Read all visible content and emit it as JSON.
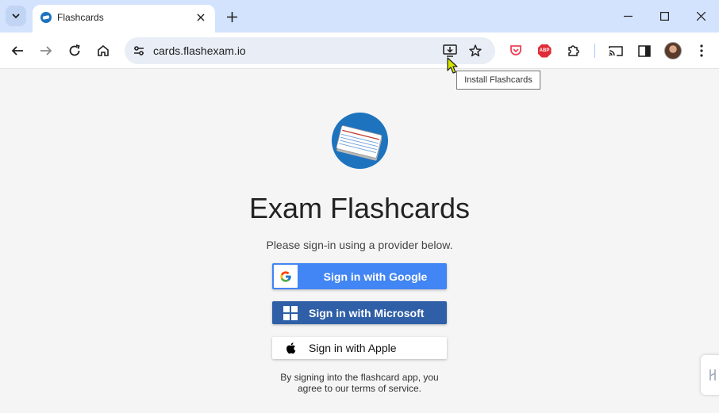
{
  "browser": {
    "tab": {
      "title": "Flashcards"
    },
    "url": "cards.flashexam.io",
    "tooltip": "Install Flashcards"
  },
  "page": {
    "heading": "Exam Flashcards",
    "subtitle": "Please sign-in using a provider below.",
    "buttons": {
      "google": "Sign in with Google",
      "microsoft": "Sign in with Microsoft",
      "apple": "Sign in with Apple"
    },
    "terms_line1": "By signing into the flashcard app, you",
    "terms_line2": "agree to our terms of service."
  },
  "colors": {
    "tabstrip": "#d3e3fd",
    "google_blue": "#4285f4",
    "microsoft_blue": "#2f5fa7",
    "logo_blue": "#1e73be"
  }
}
